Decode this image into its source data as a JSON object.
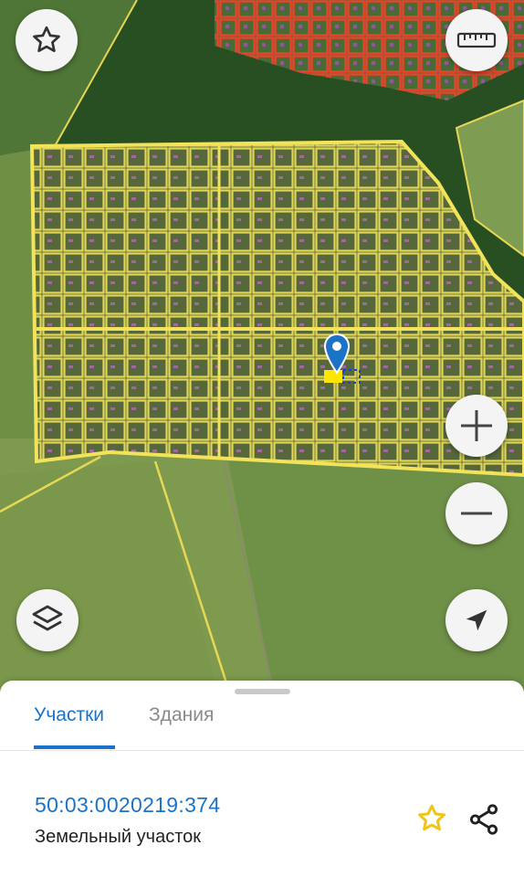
{
  "map": {
    "marker_label": "",
    "buttons": {
      "favorite": "star-outline-icon",
      "measure": "ruler-icon",
      "zoom_in": "plus-icon",
      "zoom_out": "minus-icon",
      "layers": "layers-icon",
      "locate": "location-arrow-icon"
    },
    "colors": {
      "parcel_outline": "#f2e35a",
      "selected_parcel": "#ffe600",
      "highlight_red": "#e5452c",
      "marker": "#1a73c6",
      "building": "#d86be0"
    }
  },
  "sheet": {
    "tabs": [
      {
        "label": "Участки",
        "active": true
      },
      {
        "label": "Здания",
        "active": false
      }
    ],
    "parcel": {
      "cadastral_number": "50:03:0020219:374",
      "type": "Земельный участок"
    },
    "actions": {
      "favorite": "star-icon",
      "share": "share-icon"
    },
    "colors": {
      "accent": "#1a73c6",
      "favorite_star": "#f0c419"
    }
  }
}
